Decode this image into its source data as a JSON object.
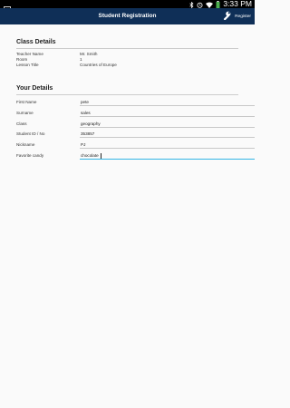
{
  "status_bar": {
    "time": "3:33 PM",
    "icons": [
      "image-notification-icon",
      "bluetooth-icon",
      "alarm-icon",
      "wifi-icon",
      "battery-icon"
    ]
  },
  "app_bar": {
    "title": "Student Registration",
    "register_label": "Register",
    "register_icon": "wrench-icon",
    "background_color": "#0f2f57"
  },
  "class_details": {
    "heading": "Class Details",
    "rows": [
      {
        "label": "Teacher Name",
        "value": "Mr. Smith"
      },
      {
        "label": "Room",
        "value": "1"
      },
      {
        "label": "Lesson Title",
        "value": "Countries of Europe"
      }
    ]
  },
  "your_details": {
    "heading": "Your Details",
    "fields": [
      {
        "label": "First Name",
        "value": "pete"
      },
      {
        "label": "Surname",
        "value": "sales"
      },
      {
        "label": "Class",
        "value": "geography"
      },
      {
        "label": "Student ID / No",
        "value": "353857"
      },
      {
        "label": "Nickname",
        "value": "PJ"
      },
      {
        "label": "Favorite candy",
        "value": "chocolate"
      }
    ],
    "focused_field": "Favorite candy"
  },
  "colors": {
    "focus_underline": "#33b5e5",
    "status_bar": "#000000",
    "page_background": "#fafafa"
  }
}
